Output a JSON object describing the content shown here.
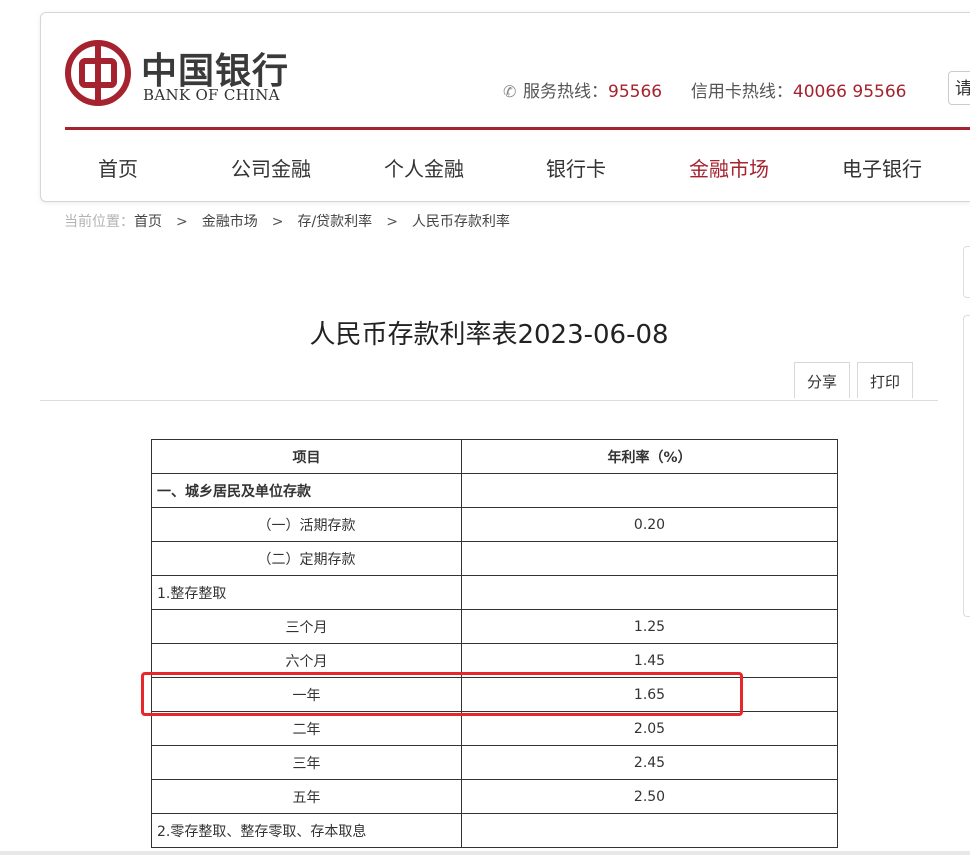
{
  "header": {
    "logo_cn": "中国银行",
    "logo_en": "BANK OF CHINA",
    "service_label": "服务热线：",
    "service_number": "95566",
    "card_label": "信用卡热线：",
    "card_number": "40066 95566",
    "search_partial": "请"
  },
  "nav": {
    "items": [
      {
        "label": "首页"
      },
      {
        "label": "公司金融"
      },
      {
        "label": "个人金融"
      },
      {
        "label": "银行卡"
      },
      {
        "label": "金融市场"
      },
      {
        "label": "电子银行"
      }
    ],
    "active": "金融市场"
  },
  "breadcrumb": {
    "prefix": "当前位置：",
    "items": [
      "首页",
      "金融市场",
      "存/贷款利率",
      "人民币存款利率"
    ],
    "separator": ">"
  },
  "page": {
    "title": "人民币存款利率表2023-06-08",
    "share": "分享",
    "print": "打印"
  },
  "table": {
    "headers": [
      "项目",
      "年利率（%）"
    ],
    "rows": [
      [
        "一、城乡居民及单位存款",
        ""
      ],
      [
        "（一）活期存款",
        "0.20"
      ],
      [
        "（二）定期存款",
        ""
      ],
      [
        "1.整存整取",
        ""
      ],
      [
        "三个月",
        "1.25"
      ],
      [
        "六个月",
        "1.45"
      ],
      [
        "一年",
        "1.65"
      ],
      [
        "二年",
        "2.05"
      ],
      [
        "三年",
        "2.45"
      ],
      [
        "五年",
        "2.50"
      ],
      [
        "2.零存整取、整存零取、存本取息",
        ""
      ]
    ]
  },
  "colors": {
    "brand_red": "#a5222f",
    "highlight_red": "#e8262b"
  }
}
